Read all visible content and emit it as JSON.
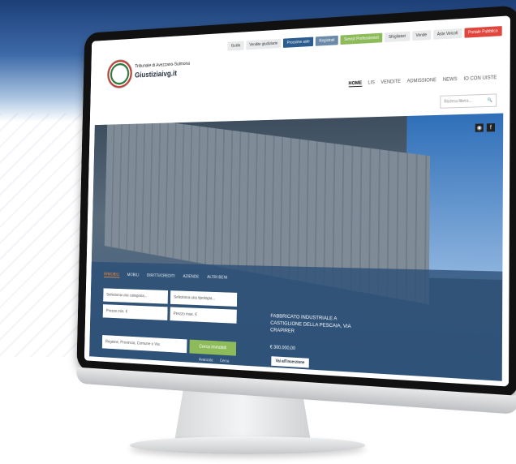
{
  "topbar": {
    "items": [
      "Guida",
      "Vendite giudiziarie",
      "Prossime aste",
      "Registrati",
      "Servizi Professionisti",
      "Sfogliatori",
      "Vende",
      "Aste Veicoli",
      "Portale Pubblico"
    ]
  },
  "brand": {
    "subtitle": "Tribunale di Avezzano-Sulmona",
    "title": "Giustiziaivg.it"
  },
  "nav": {
    "items": [
      "HOME",
      "LIS",
      "VENDITE",
      "ADMISSIONE",
      "NEWS",
      "IO CON UISTE"
    ]
  },
  "search_mini": {
    "placeholder": "Ricerca libera..."
  },
  "hero_panel": {
    "tabs": [
      "IMMOBILI",
      "MOBILI",
      "DIRITTI/CREDITI",
      "AZIENDE",
      "ALTRI BENI"
    ],
    "select_category": "Seleziona una categoria...",
    "select_type": "Seleziona una tipologia...",
    "price_min": "Prezzo min. €",
    "price_max": "Prezzo max. €",
    "location": "Regione, Provincia, Comune o Via",
    "search_button": "Cerca immobili",
    "link_1": "Avanzata",
    "link_2": "Cerca"
  },
  "featured": {
    "title": "FABBRICATO INDUSTRIALE A CASTIGLIONE DELLA PESCAIA, VIA CRAPIRER",
    "price": "€ 300.000,00",
    "button": "Vai all'inserzione"
  },
  "colors": {
    "primary": "#2b5c8f",
    "accent_orange": "#f08a3c",
    "accent_green": "#8dbb5a",
    "accent_red": "#e0463e"
  }
}
